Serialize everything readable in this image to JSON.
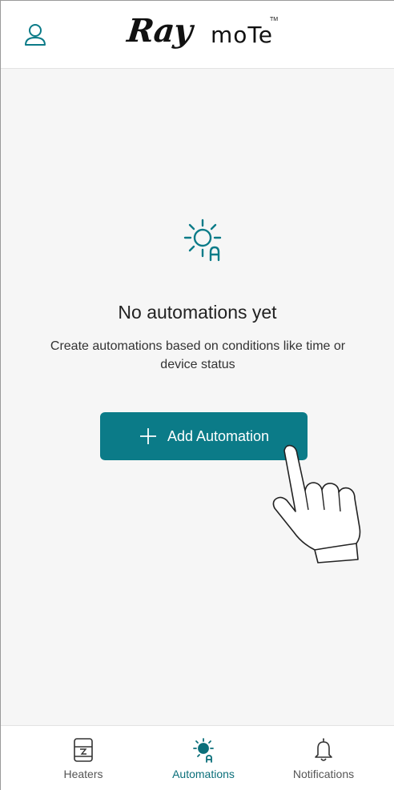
{
  "header": {
    "logo_main": "Ray",
    "logo_suffix": "moTe",
    "logo_tm": "TM"
  },
  "empty_state": {
    "icon": "automation-sun-icon",
    "title": "No automations yet",
    "description": "Create automations based on conditions like time or device status",
    "button_label": "Add Automation"
  },
  "bottom_nav": {
    "items": [
      {
        "label": "Heaters",
        "icon": "heater-icon",
        "active": false
      },
      {
        "label": "Automations",
        "icon": "automation-icon",
        "active": true
      },
      {
        "label": "Notifications",
        "icon": "bell-icon",
        "active": false
      }
    ]
  },
  "colors": {
    "accent": "#0b7b88",
    "active_nav": "#0b6f7a",
    "background": "#f6f6f6"
  }
}
